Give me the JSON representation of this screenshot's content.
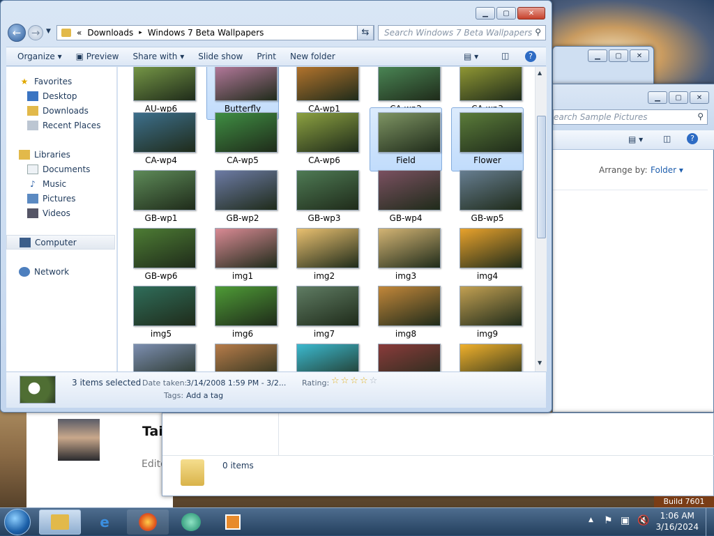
{
  "explorer": {
    "address": {
      "crumb1": "Downloads",
      "crumb2": "Windows 7 Beta Wallpapers",
      "chev": "«"
    },
    "search_placeholder": "Search Windows 7 Beta Wallpapers",
    "toolbar": [
      "Organize",
      "Preview",
      "Share with",
      "Slide show",
      "Print",
      "New folder"
    ],
    "nav": {
      "favorites": "Favorites",
      "desktop": "Desktop",
      "downloads": "Downloads",
      "recent": "Recent Places",
      "libraries": "Libraries",
      "documents": "Documents",
      "music": "Music",
      "pictures": "Pictures",
      "videos": "Videos",
      "computer": "Computer",
      "network": "Network"
    },
    "tiles": [
      {
        "label": "AU-wp6",
        "color": "#7da04a"
      },
      {
        "label": "Butterfly",
        "color": "#c07fa6",
        "sel": true
      },
      {
        "label": "CA-wp1",
        "color": "#c07a2e"
      },
      {
        "label": "CA-wp2",
        "color": "#4e8e5a"
      },
      {
        "label": "CA-wp3",
        "color": "#9aa136"
      },
      {
        "label": "CA-wp4",
        "color": "#3d6f8c"
      },
      {
        "label": "CA-wp5",
        "color": "#3f8e43"
      },
      {
        "label": "CA-wp6",
        "color": "#8ca141"
      },
      {
        "label": "Field",
        "color": "#7e9463",
        "sel": true
      },
      {
        "label": "Flower",
        "color": "#5b7c3a",
        "sel": true
      },
      {
        "label": "GB-wp1",
        "color": "#5d8a58"
      },
      {
        "label": "GB-wp2",
        "color": "#6c7aa4"
      },
      {
        "label": "GB-wp3",
        "color": "#4e7a54"
      },
      {
        "label": "GB-wp4",
        "color": "#7a5060"
      },
      {
        "label": "GB-wp5",
        "color": "#667d90"
      },
      {
        "label": "GB-wp6",
        "color": "#4d7c34"
      },
      {
        "label": "img1",
        "color": "#d98a94"
      },
      {
        "label": "img2",
        "color": "#e9c070"
      },
      {
        "label": "img3",
        "color": "#d3b474"
      },
      {
        "label": "img4",
        "color": "#e8a22c"
      },
      {
        "label": "img5",
        "color": "#2f6d5a"
      },
      {
        "label": "img6",
        "color": "#4e9b36"
      },
      {
        "label": "img7",
        "color": "#5f7c63"
      },
      {
        "label": "img8",
        "color": "#c2873a"
      },
      {
        "label": "img9",
        "color": "#c2a052"
      },
      {
        "label": "",
        "color": "#7c8eb0"
      },
      {
        "label": "",
        "color": "#b77c4a"
      },
      {
        "label": "",
        "color": "#3bb9cf"
      },
      {
        "label": "",
        "color": "#8a3b3b"
      },
      {
        "label": "",
        "color": "#f0b02c"
      }
    ],
    "details": {
      "selected": "3 items selected",
      "date_label": "Date taken:",
      "date_value": "3/14/2008 1:59 PM - 3/2...",
      "rating_label": "Rating:",
      "tags_label": "Tags:",
      "tags_value": "Add a tag"
    }
  },
  "second": {
    "search": "earch Sample Pictures",
    "arrange_label": "Arrange by:",
    "arrange_value": "Folder",
    "items": "0 items"
  },
  "background": {
    "title_fragment": "Tai",
    "edito": "Edito"
  },
  "taskbar": {
    "time": "1:06 AM",
    "date": "3/16/2024",
    "build": "Build 7601"
  }
}
